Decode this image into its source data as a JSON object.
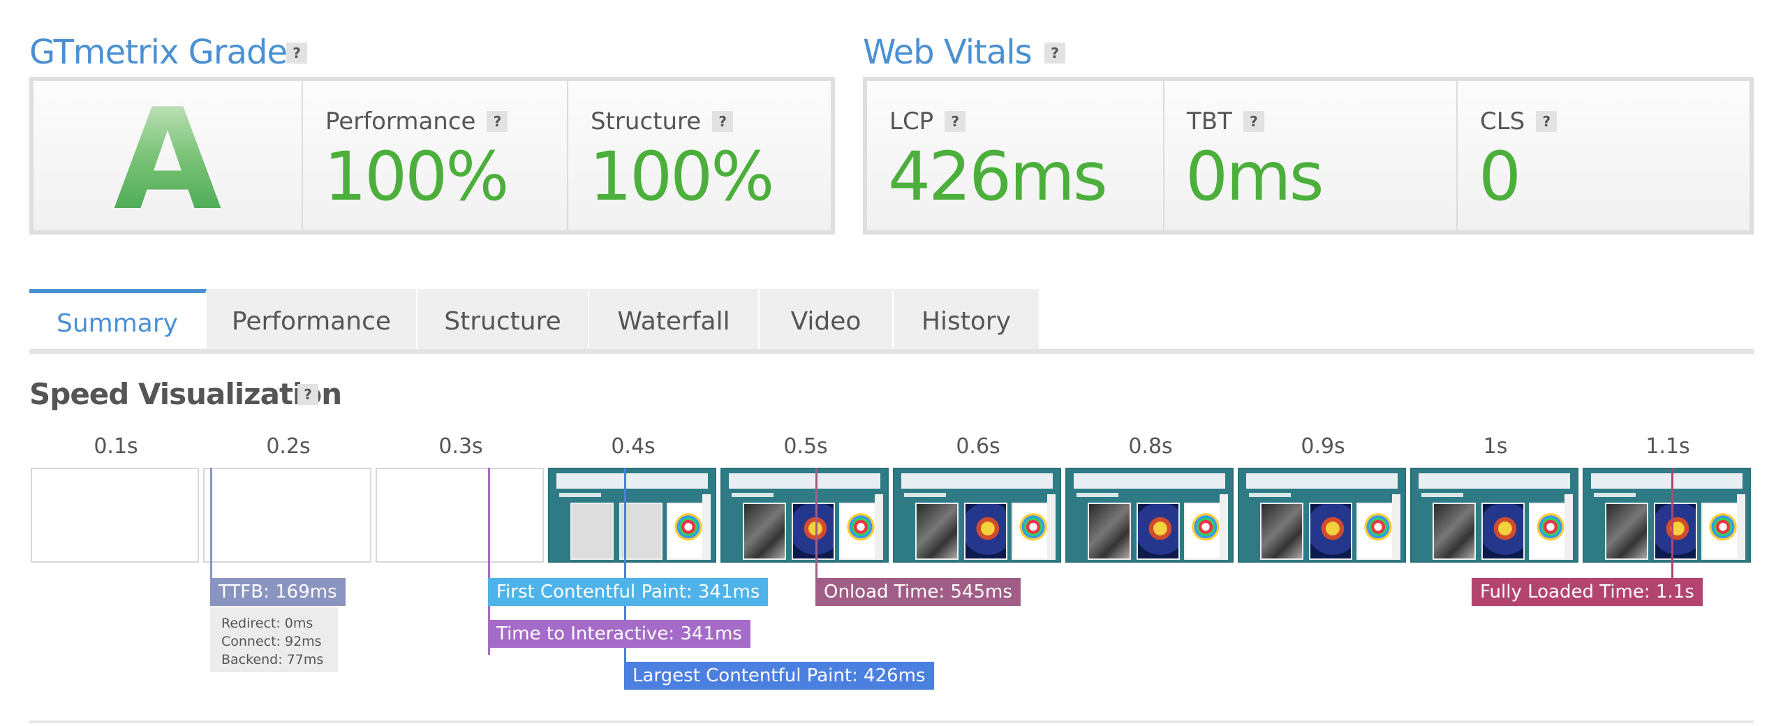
{
  "grade_section": {
    "title": "GTmetrix Grade",
    "help": "?",
    "grade": "A",
    "performance": {
      "label": "Performance",
      "help": "?",
      "value": "100%"
    },
    "structure": {
      "label": "Structure",
      "help": "?",
      "value": "100%"
    }
  },
  "vitals_section": {
    "title": "Web Vitals",
    "help": "?",
    "lcp": {
      "label": "LCP",
      "help": "?",
      "value": "426ms"
    },
    "tbt": {
      "label": "TBT",
      "help": "?",
      "value": "0ms"
    },
    "cls": {
      "label": "CLS",
      "help": "?",
      "value": "0"
    }
  },
  "tabs": [
    "Summary",
    "Performance",
    "Structure",
    "Waterfall",
    "Video",
    "History"
  ],
  "active_tab": "Summary",
  "speed": {
    "title": "Speed Visualization",
    "help": "?",
    "frames": [
      "0.1s",
      "0.2s",
      "0.3s",
      "0.4s",
      "0.5s",
      "0.6s",
      "0.8s",
      "0.9s",
      "1s",
      "1.1s"
    ],
    "markers": {
      "ttfb": "TTFB: 169ms",
      "fcp": "First Contentful Paint: 341ms",
      "tti": "Time to Interactive: 341ms",
      "lcp": "Largest Contentful Paint: 426ms",
      "onload": "Onload Time: 545ms",
      "fully_loaded": "Fully Loaded Time: 1.1s"
    },
    "ttfb_details": {
      "redirect": "Redirect: 0ms",
      "connect": "Connect: 92ms",
      "backend": "Backend: 77ms"
    }
  },
  "colors": {
    "accent": "#4a90d2",
    "good": "#4caf3c",
    "ttfb": "#8a94c1",
    "fcp": "#4fb3ea",
    "tti": "#a56bc8",
    "lcp": "#4b7fe0",
    "onload": "#a05d86",
    "fully_loaded": "#b2446f"
  }
}
